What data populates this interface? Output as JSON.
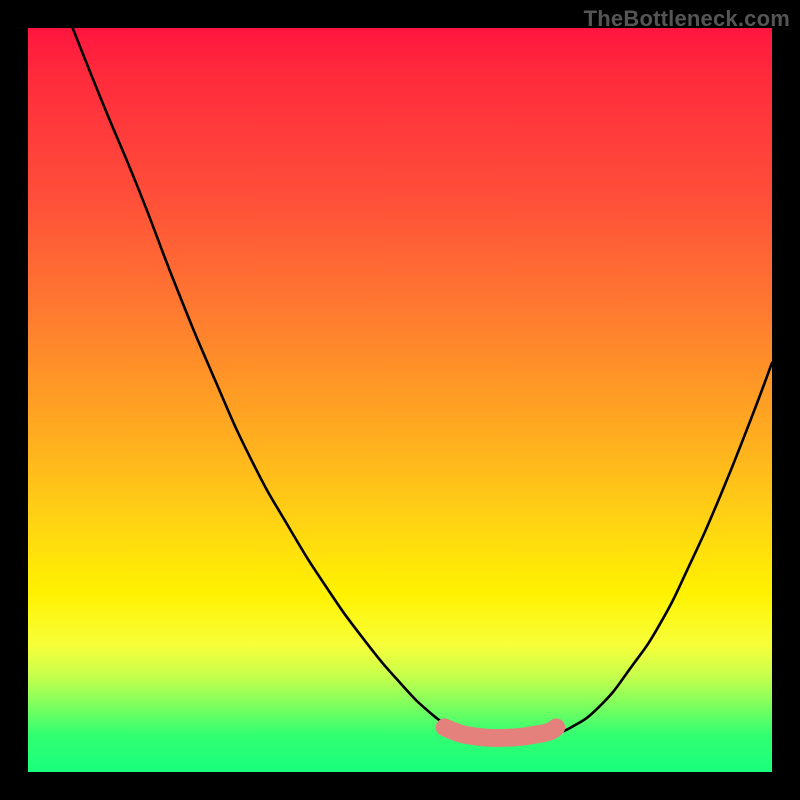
{
  "watermark": "TheBottleneck.com",
  "chart_data": {
    "type": "line",
    "title": "",
    "xlabel": "",
    "ylabel": "",
    "xlim": [
      0,
      100
    ],
    "ylim": [
      0,
      100
    ],
    "grid": false,
    "legend": false,
    "series": [
      {
        "name": "left-curve",
        "x": [
          6,
          10,
          15,
          20,
          25,
          30,
          35,
          40,
          45,
          50,
          54,
          57,
          59
        ],
        "values": [
          100,
          90,
          78,
          65,
          53,
          42,
          33,
          25,
          18,
          12,
          8,
          6,
          5
        ]
      },
      {
        "name": "right-curve",
        "x": [
          70,
          73,
          77,
          81,
          85,
          89,
          93,
          97,
          100
        ],
        "values": [
          5,
          6,
          9,
          14,
          20,
          28,
          37,
          47,
          55
        ]
      },
      {
        "name": "bottom-highlight",
        "x": [
          56,
          58,
          60,
          62,
          64,
          66,
          68,
          70,
          71
        ],
        "values": [
          6,
          5.2,
          4.8,
          4.6,
          4.6,
          4.7,
          5.0,
          5.4,
          6
        ]
      }
    ],
    "colors": {
      "curve": "#000000",
      "highlight": "#e4817c"
    },
    "background_gradient_stops": [
      {
        "pos": 0.0,
        "hex": "#ff153f"
      },
      {
        "pos": 0.22,
        "hex": "#ff4d3a"
      },
      {
        "pos": 0.54,
        "hex": "#ffaa20"
      },
      {
        "pos": 0.76,
        "hex": "#fff200"
      },
      {
        "pos": 0.87,
        "hex": "#c8ff4a"
      },
      {
        "pos": 1.0,
        "hex": "#19ff7c"
      }
    ]
  }
}
